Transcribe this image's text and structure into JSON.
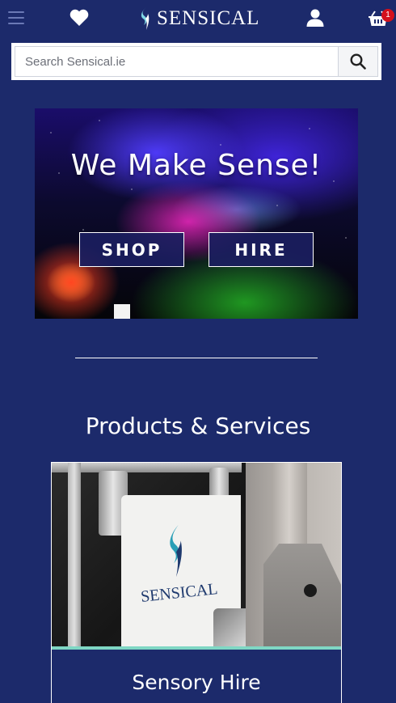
{
  "header": {
    "brand": "SENSICAL",
    "cart_count": "1",
    "icons": [
      "menu-icon",
      "heart-icon",
      "user-icon",
      "cart-icon"
    ]
  },
  "search": {
    "placeholder": "Search Sensical.ie",
    "value": ""
  },
  "hero": {
    "title": "We Make Sense!",
    "buttons": {
      "shop": "SHOP",
      "hire": "HIRE"
    }
  },
  "products": {
    "heading": "Products & Services",
    "cards": [
      {
        "title": "Sensory Hire",
        "image_brand": "SENSICAL"
      }
    ]
  },
  "colors": {
    "background": "#1c2a6b",
    "badge": "#d4101c",
    "card_accent": "#7fd7c4"
  }
}
